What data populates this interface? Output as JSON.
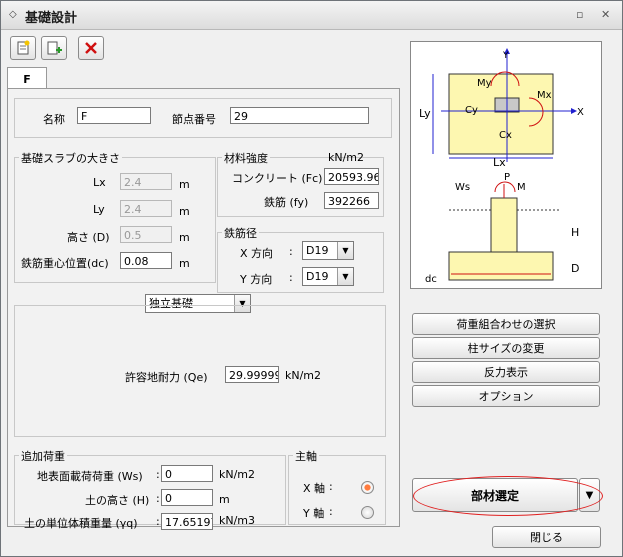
{
  "window": {
    "title": "基礎設計"
  },
  "toolbar": {
    "icons": [
      "new-document-icon",
      "add-document-icon",
      "delete-icon"
    ]
  },
  "tab": {
    "label": "F"
  },
  "top": {
    "name_label": "名称",
    "name_value": "F",
    "node_label": "節点番号",
    "node_value": "29"
  },
  "slab": {
    "title": "基礎スラブの大きさ",
    "lx_label": "Lx",
    "lx_value": "2.4",
    "lx_unit": "m",
    "ly_label": "Ly",
    "ly_value": "2.4",
    "ly_unit": "m",
    "d_label": "高さ (D)",
    "d_value": "0.5",
    "d_unit": "m",
    "dc_label": "鉄筋重心位置(dc)",
    "dc_value": "0.08",
    "dc_unit": "m"
  },
  "material": {
    "title": "材料強度",
    "unit": "kN/m2",
    "fc_label": "コンクリート (Fc)",
    "fc_value": "20593.965",
    "fy_label": "鉄筋 (fy)",
    "fy_value": "392266"
  },
  "rebar": {
    "title": "鉄筋径",
    "x_label": "X 方向",
    "x_value": "D19",
    "y_label": "Y 方向",
    "y_value": "D19"
  },
  "foundation": {
    "type_value": "独立基礎",
    "qe_label": "許容地耐力 (Qe)",
    "qe_value": "29.999999",
    "qe_unit": "kN/m2"
  },
  "load": {
    "title": "追加荷重",
    "ws_label": "地表面載荷荷重 (Ws)",
    "ws_value": "0",
    "ws_unit": "kN/m2",
    "h_label": "土の高さ (H)",
    "h_value": "0",
    "h_unit": "m",
    "gamma_label": "土の単位体積重量 (γq)",
    "gamma_value": "17.65197",
    "gamma_unit": "kN/m3"
  },
  "axis": {
    "title": "主軸",
    "x_label": "X 軸",
    "y_label": "Y 軸",
    "selected": "X"
  },
  "buttons": {
    "load_combo": "荷重組合わせの選択",
    "column_size": "柱サイズの変更",
    "reaction": "反力表示",
    "option": "オプション",
    "select_member": "部材選定",
    "close": "閉じる"
  },
  "diagram": {
    "labels": {
      "y": "Y",
      "x": "X",
      "my": "My",
      "mx": "Mx",
      "cy": "Cy",
      "cx": "Cx",
      "ly": "Ly",
      "lx": "Lx",
      "ws": "Ws",
      "p": "P",
      "m": "M",
      "h": "H",
      "d": "D",
      "dc": "dc"
    },
    "colors": {
      "slab": "#fdf7b0",
      "column": "#c8c8c8",
      "axis": "#2020d0",
      "moment": "#d01010"
    }
  }
}
